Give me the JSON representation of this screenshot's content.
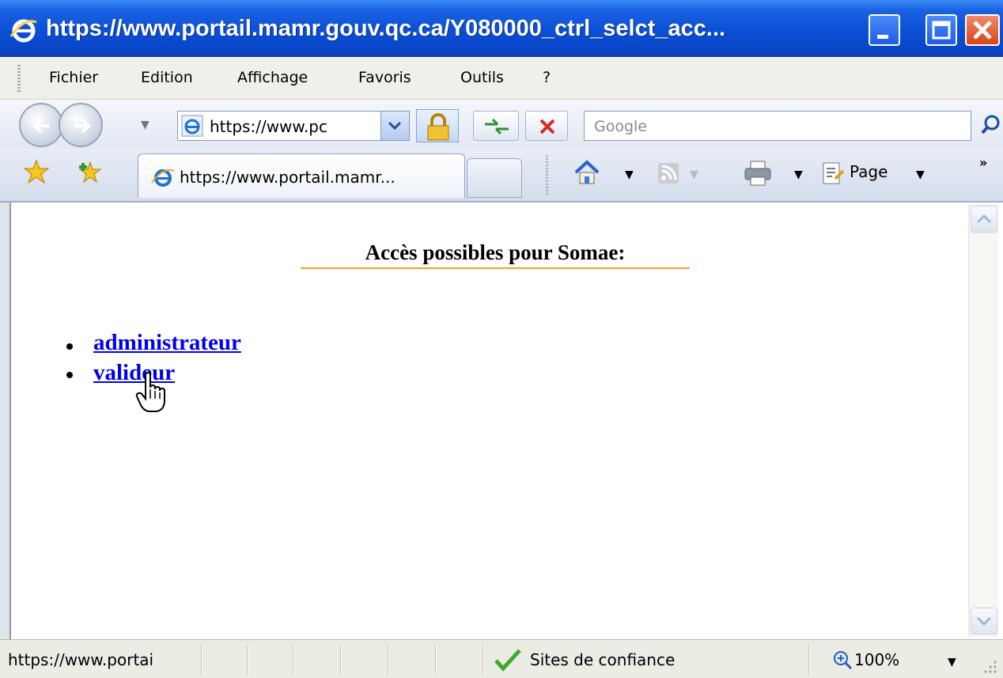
{
  "window": {
    "title": "https://www.portail.mamr.gouv.qc.ca/Y080000_ctrl_selct_acc..."
  },
  "menu": {
    "items": [
      "Fichier",
      "Edition",
      "Affichage",
      "Favoris",
      "Outils",
      "?"
    ]
  },
  "navigation": {
    "address": "https://www.pc",
    "search_placeholder": "Google"
  },
  "tab": {
    "label": "https://www.portail.mamr..."
  },
  "command_bar": {
    "page_label": "Page",
    "more": "»"
  },
  "content": {
    "heading": "Accès possibles pour Somae:",
    "links": [
      "administrateur",
      "valideur"
    ]
  },
  "status": {
    "url": "https://www.portai",
    "zone": "Sites de confiance",
    "zoom": "100%"
  },
  "colors": {
    "titlebar": "#0b4fd6",
    "link": "#0000ee",
    "heading_underline": "#f0a030"
  }
}
